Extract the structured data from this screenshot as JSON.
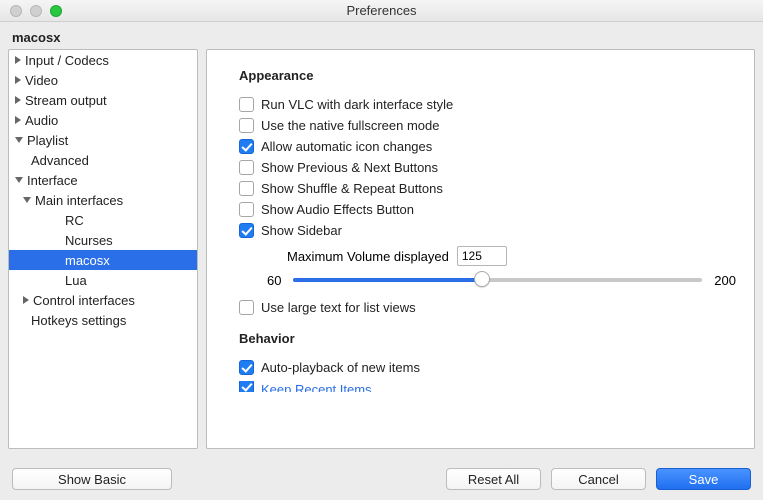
{
  "window": {
    "title": "Preferences"
  },
  "header": {
    "title": "macosx"
  },
  "sidebar": {
    "items": [
      {
        "label": "Input / Codecs"
      },
      {
        "label": "Video"
      },
      {
        "label": "Stream output"
      },
      {
        "label": "Audio"
      },
      {
        "label": "Playlist"
      },
      {
        "label": "Advanced"
      },
      {
        "label": "Interface"
      },
      {
        "label": "Main interfaces"
      },
      {
        "label": "RC"
      },
      {
        "label": "Ncurses"
      },
      {
        "label": "macosx"
      },
      {
        "label": "Lua"
      },
      {
        "label": "Control interfaces"
      },
      {
        "label": "Hotkeys settings"
      }
    ]
  },
  "main": {
    "appearance": {
      "heading": "Appearance",
      "dark": {
        "label": "Run VLC with dark interface style",
        "checked": false
      },
      "nativefs": {
        "label": "Use the native fullscreen mode",
        "checked": false
      },
      "iconchanges": {
        "label": "Allow automatic icon changes",
        "checked": true
      },
      "prevnext": {
        "label": "Show Previous & Next Buttons",
        "checked": false
      },
      "shuffle": {
        "label": "Show Shuffle & Repeat Buttons",
        "checked": false
      },
      "audiofx": {
        "label": "Show Audio Effects Button",
        "checked": false
      },
      "sidebar": {
        "label": "Show Sidebar",
        "checked": true
      },
      "maxvol": {
        "label": "Maximum Volume displayed",
        "value": "125"
      },
      "slider": {
        "min": "60",
        "max": "200",
        "value": 125
      },
      "largetext": {
        "label": "Use large text for list views",
        "checked": false
      }
    },
    "behavior": {
      "heading": "Behavior",
      "autoplay": {
        "label": "Auto-playback of new items",
        "checked": true
      },
      "recent": {
        "label": "Keep Recent Items",
        "checked": true
      }
    }
  },
  "footer": {
    "show_basic": "Show Basic",
    "reset": "Reset All",
    "cancel": "Cancel",
    "save": "Save"
  }
}
